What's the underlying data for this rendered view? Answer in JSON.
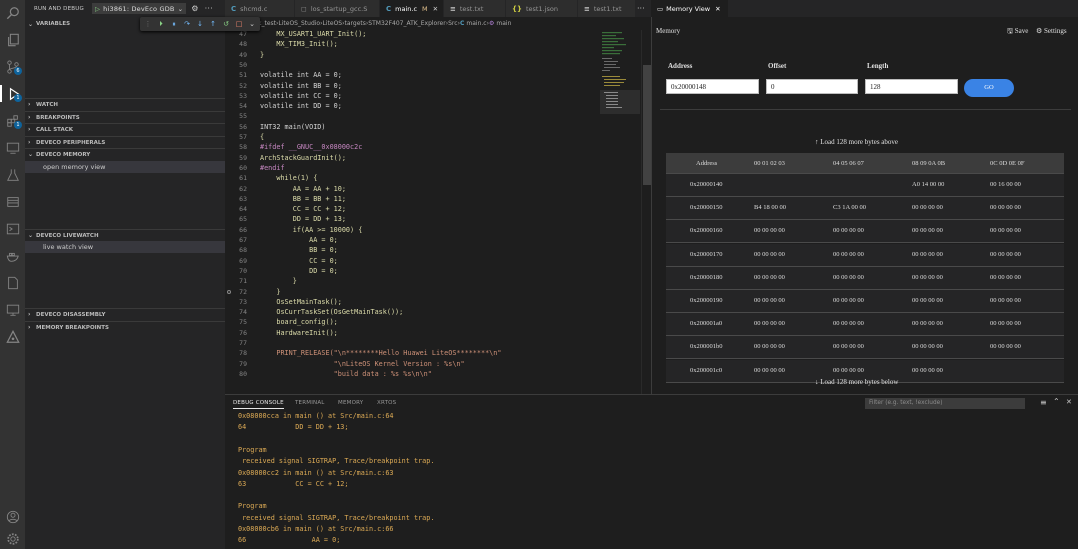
{
  "sidebar": {
    "title": "RUN AND DEBUG",
    "config_name": "hi3861: DevEco GDB",
    "sections": {
      "variables": "VARIABLES",
      "watch": "WATCH",
      "breakpoints": "BREAKPOINTS",
      "call_stack": "CALL STACK",
      "peripherals": "DEVECO PERIPHERALS",
      "memory": "DEVECO MEMORY",
      "memory_item": "open memory view",
      "livewatch": "DEVECO LIVEWATCH",
      "livewatch_item": "live watch view",
      "disassembly": "DEVECO DISASSEMBLY",
      "memory_breakpoints": "MEMORY BREAKPOINTS"
    }
  },
  "activity_badges": {
    "scm": "6",
    "debug": "1",
    "extensions": "1"
  },
  "editor": {
    "tabs": [
      {
        "icon": "C",
        "label": "shcmd.c",
        "active": false
      },
      {
        "icon": "◻",
        "label": "los_startup_gcc.S",
        "active": false
      },
      {
        "icon": "C",
        "label": "main.c",
        "active": true,
        "modified": "M"
      },
      {
        "icon": "≡",
        "label": "test.txt",
        "active": false
      },
      {
        "icon": "{}",
        "label": "test1.json",
        "active": false
      },
      {
        "icon": "≡",
        "label": "test1.txt",
        "active": false
      }
    ],
    "breadcrumb": [
      "k_test",
      "LiteOS_Studio",
      "LiteOS",
      "targets",
      "STM32F407_ATK_Explorer",
      "Src",
      "main.c",
      "main"
    ],
    "lines": [
      {
        "n": "47",
        "t": "    MX_USART1_UART_Init();"
      },
      {
        "n": "48",
        "t": "    MX_TIM3_Init();"
      },
      {
        "n": "49",
        "t": "}"
      },
      {
        "n": "50",
        "t": ""
      },
      {
        "n": "51",
        "t": "volatile int AA = 0;"
      },
      {
        "n": "52",
        "t": "volatile int BB = 0;"
      },
      {
        "n": "53",
        "t": "volatile int CC = 0;"
      },
      {
        "n": "54",
        "t": "volatile int DD = 0;"
      },
      {
        "n": "55",
        "t": ""
      },
      {
        "n": "56",
        "t": "INT32 main(VOID)"
      },
      {
        "n": "57",
        "t": "{"
      },
      {
        "n": "58",
        "t": "#ifdef __GNUC__0x08000c2c"
      },
      {
        "n": "59",
        "t": "ArchStackGuardInit();"
      },
      {
        "n": "60",
        "t": "#endif"
      },
      {
        "n": "61",
        "t": "    while(1) {"
      },
      {
        "n": "62",
        "t": "        AA = AA + 10;"
      },
      {
        "n": "63",
        "t": "        BB = BB + 11;"
      },
      {
        "n": "64",
        "t": "        CC = CC + 12;"
      },
      {
        "n": "65",
        "t": "        DD = DD + 13;"
      },
      {
        "n": "66",
        "t": "        if(AA >= 10000) {"
      },
      {
        "n": "67",
        "t": "            AA = 0;"
      },
      {
        "n": "68",
        "t": "            BB = 0;"
      },
      {
        "n": "69",
        "t": "            CC = 0;"
      },
      {
        "n": "70",
        "t": "            DD = 0;"
      },
      {
        "n": "71",
        "t": "        }"
      },
      {
        "n": "72",
        "t": "    }"
      },
      {
        "n": "73",
        "t": "    OsSetMainTask();"
      },
      {
        "n": "74",
        "t": "    OsCurrTaskSet(OsGetMainTask());"
      },
      {
        "n": "75",
        "t": "    board_config();"
      },
      {
        "n": "76",
        "t": "    HardwareInit();"
      },
      {
        "n": "77",
        "t": ""
      },
      {
        "n": "78",
        "t": "    PRINT_RELEASE(\"\\n********Hello Huawei LiteOS********\\n\""
      },
      {
        "n": "79",
        "t": "                  \"\\nLiteOS Kernel Version : %s\\n\""
      },
      {
        "n": "80",
        "t": "                  \"build data : %s %s\\n\\n\""
      }
    ]
  },
  "memory_view": {
    "tab_label": "Memory View",
    "title": "Memory",
    "save_label": "Save",
    "settings_label": "Settings",
    "address_label": "Address",
    "offset_label": "Offset",
    "length_label": "Length",
    "address_value": "0x20000148",
    "offset_value": "0",
    "length_value": "128",
    "go_label": "GO",
    "load_above": "Load 128 more bytes above",
    "load_below": "Load 128 more bytes below",
    "headers": [
      "Address",
      "00 01 02 03",
      "04 05 06 07",
      "08 09 0A 0B",
      "0C 0D 0E 0F"
    ],
    "rows": [
      {
        "addr": "0x20000140",
        "g": [
          "",
          "",
          "A0 14 00 00",
          "00 16 00 00"
        ]
      },
      {
        "addr": "0x20000150",
        "g": [
          "B4 18 00 00",
          "C3 1A 00 00",
          "00 00 00 00",
          "00 00 00 00"
        ]
      },
      {
        "addr": "0x20000160",
        "g": [
          "00 00 00 00",
          "00 00 00 00",
          "00 00 00 00",
          "00 00 00 00"
        ]
      },
      {
        "addr": "0x20000170",
        "g": [
          "00 00 00 00",
          "00 00 00 00",
          "00 00 00 00",
          "00 00 00 00"
        ]
      },
      {
        "addr": "0x20000180",
        "g": [
          "00 00 00 00",
          "00 00 00 00",
          "00 00 00 00",
          "00 00 00 00"
        ]
      },
      {
        "addr": "0x20000190",
        "g": [
          "00 00 00 00",
          "00 00 00 00",
          "00 00 00 00",
          "00 00 00 00"
        ]
      },
      {
        "addr": "0x200001a0",
        "g": [
          "00 00 00 00",
          "00 00 00 00",
          "00 00 00 00",
          "00 00 00 00"
        ]
      },
      {
        "addr": "0x200001b0",
        "g": [
          "00 00 00 00",
          "00 00 00 00",
          "00 00 00 00",
          "00 00 00 00"
        ]
      },
      {
        "addr": "0x200001c0",
        "g": [
          "00 00 00 00",
          "00 00 00 00",
          "00 00 00 00",
          ""
        ]
      }
    ]
  },
  "panel": {
    "tabs": [
      "DEBUG CONSOLE",
      "TERMINAL",
      "MEMORY",
      "XRTOS"
    ],
    "filter_placeholder": "Filter (e.g. text, !exclude)",
    "console": [
      {
        "t": "0x08000cca in main () at Src/main.c:64",
        "c": "addr"
      },
      {
        "t": "64            DD = DD + 13;",
        "c": "addr"
      },
      {
        "t": "",
        "c": "addr"
      },
      {
        "t": "Program",
        "c": "addr"
      },
      {
        "t": " received signal SIGTRAP, Trace/breakpoint trap.",
        "c": "addr"
      },
      {
        "t": "0x08000cc2 in main () at Src/main.c:63",
        "c": "addr"
      },
      {
        "t": "63            CC = CC + 12;",
        "c": "addr"
      },
      {
        "t": "",
        "c": "addr"
      },
      {
        "t": "Program",
        "c": "addr"
      },
      {
        "t": " received signal SIGTRAP, Trace/breakpoint trap.",
        "c": "addr"
      },
      {
        "t": "0x08000cb6 in main () at Src/main.c:66",
        "c": "addr"
      },
      {
        "t": "66                AA = 0;",
        "c": "addr"
      }
    ]
  }
}
